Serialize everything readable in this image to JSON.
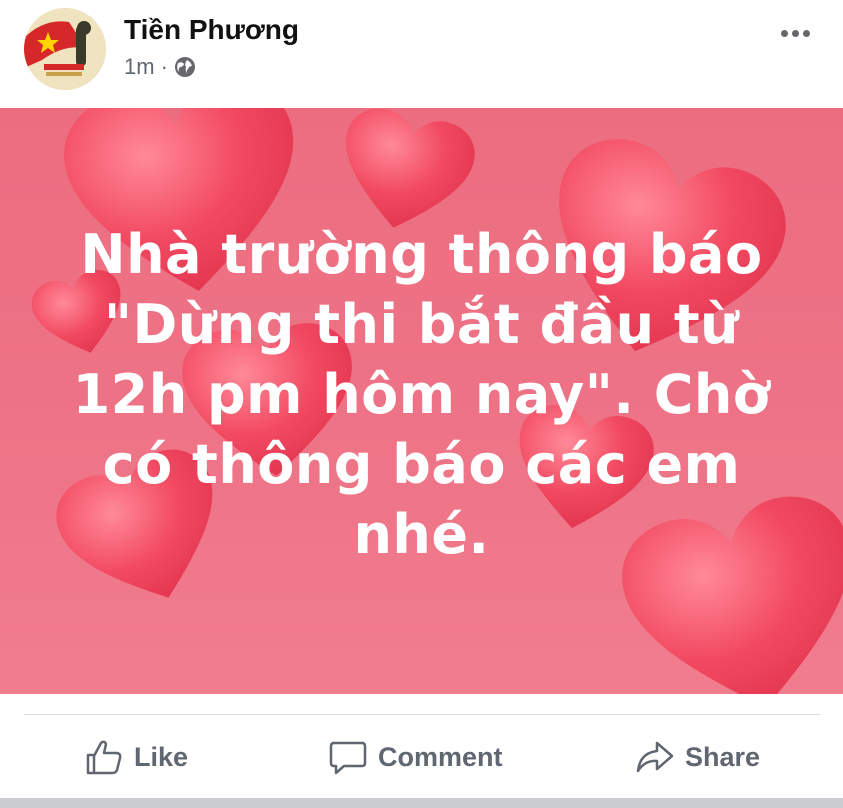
{
  "post": {
    "author": "Tiền Phương",
    "time": "1m",
    "separator": "·",
    "privacy_icon": "globe-icon",
    "more_icon": "more-dots-icon",
    "text_lines": [
      "Nhà trường thông báo",
      "\"Dừng thi bắt đầu từ",
      "12h pm hôm nay\". Chờ",
      "có thông báo các em",
      "nhé."
    ],
    "background_color": "#ee7386",
    "heart_color": "#f0475e"
  },
  "actions": {
    "like_label": "Like",
    "comment_label": "Comment",
    "share_label": "Share"
  },
  "colors": {
    "action_text": "#606770",
    "divider": "#d8dade"
  }
}
